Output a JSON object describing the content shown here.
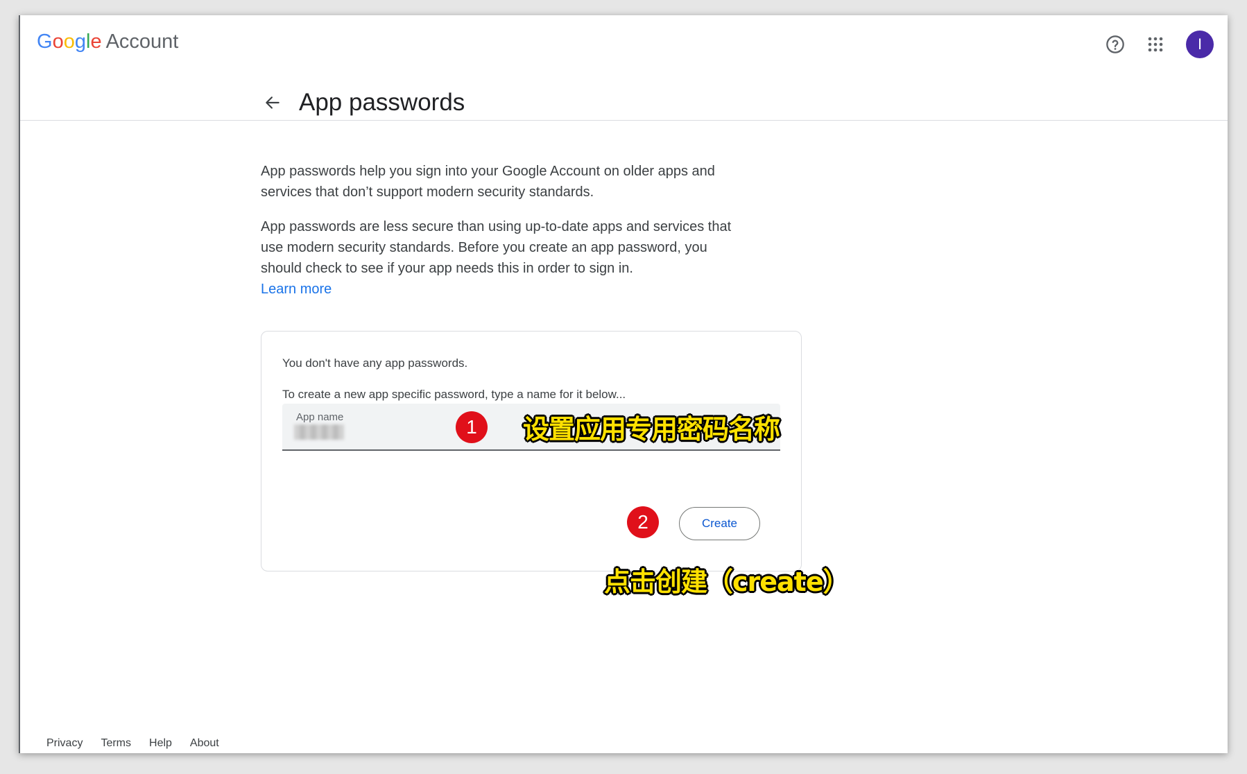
{
  "header": {
    "logo_letters": [
      "G",
      "o",
      "o",
      "g",
      "l",
      "e"
    ],
    "logo_colors": [
      "#4285F4",
      "#EA4335",
      "#FBBC05",
      "#4285F4",
      "#34A853",
      "#EA4335"
    ],
    "logo_suffix": "Account",
    "help_icon": "help-circle-icon",
    "apps_icon": "apps-grid-icon",
    "avatar_initial": "I",
    "avatar_color": "#4a2aa8"
  },
  "page": {
    "title": "App passwords",
    "back_icon": "arrow-back-icon"
  },
  "intro": {
    "paragraph1": "App passwords help you sign into your Google Account on older apps and services that don’t support modern security standards.",
    "paragraph2": "App passwords are less secure than using up-to-date apps and services that use modern security standards. Before you create an app password, you should check to see if your app needs this in order to sign in.",
    "learn_more": "Learn more"
  },
  "card": {
    "empty_text": "You don't have any app passwords.",
    "instruction": "To create a new app specific password, type a name for it below...",
    "field_label": "App name",
    "create_label": "Create"
  },
  "annotations": {
    "step1": "1",
    "step1_text": "设置应用专用密码名称",
    "step2": "2",
    "step2_text": "点击创建（create）",
    "badge_color": "#e0101a",
    "text_color": "#ffe100"
  },
  "footer": {
    "links": [
      "Privacy",
      "Terms",
      "Help",
      "About"
    ]
  }
}
